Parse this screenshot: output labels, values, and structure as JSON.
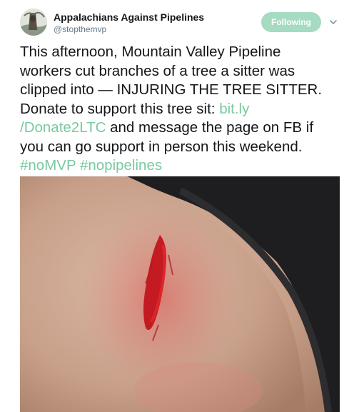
{
  "author": {
    "display_name": "Appalachians Against Pipelines",
    "handle": "@stopthemvp",
    "avatar_icon": "avatar-photo-icon"
  },
  "follow_button": {
    "label": "Following",
    "color": "#a5dbc1"
  },
  "caret_icon": "chevron-down-icon",
  "tweet": {
    "line1": "This afternoon, Mountain Valley Pipeline",
    "line2": "workers cut branches of a tree a sitter was",
    "line3": "clipped into — INJURING THE TREE SITTER.",
    "line4_text": "Donate to support this tree sit: ",
    "line4_link": "bit.ly",
    "line5_link": "/Donate2LTC",
    "line5_text": " and message the page on FB if",
    "line6": "you can go support in person this weekend.",
    "hashtag1": "#noMVP",
    "hashtag2": "#nopipelines",
    "link_color": "#79c9a1"
  },
  "media": {
    "description_icon": "injury-photo"
  }
}
